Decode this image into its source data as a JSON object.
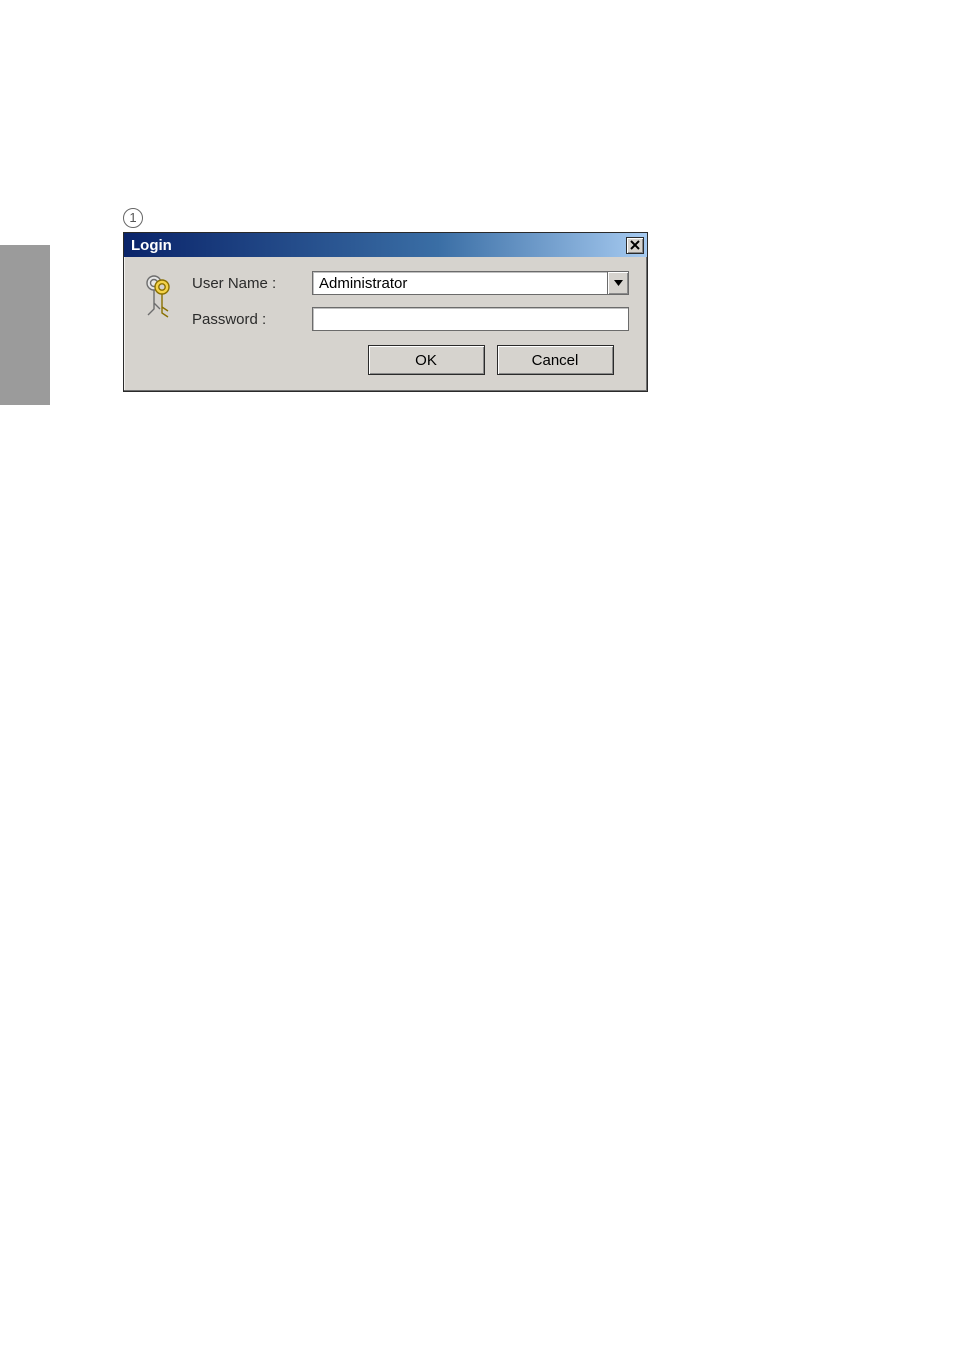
{
  "callout": {
    "number": "1"
  },
  "dialog": {
    "title": "Login",
    "username_label": "User Name :",
    "username_value": "Administrator",
    "password_label": "Password :",
    "password_value": "",
    "ok_label": "OK",
    "cancel_label": "Cancel"
  }
}
